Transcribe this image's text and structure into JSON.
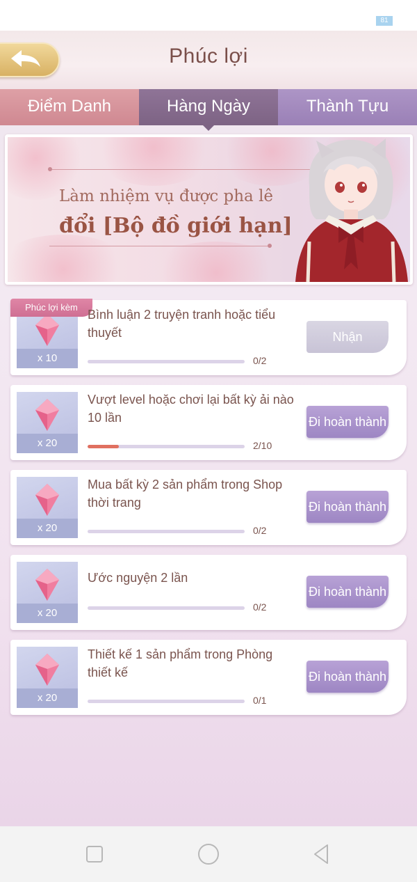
{
  "status_bar": {
    "battery": "81"
  },
  "header": {
    "title": "Phúc lợi"
  },
  "tabs": [
    {
      "label": "Điểm Danh"
    },
    {
      "label": "Hàng Ngày"
    },
    {
      "label": "Thành Tựu"
    }
  ],
  "banner": {
    "line1": "Làm nhiệm vụ được pha lê",
    "line2": "đổi [Bộ đồ giới hạn]"
  },
  "tasks": [
    {
      "title": "Bình luận 2 truyện tranh hoặc tiểu thuyết",
      "reward_qty": "x 10",
      "progress_text": "0/2",
      "progress": 0,
      "button": "Nhận",
      "bonus_tag": "Phúc lợi kèm"
    },
    {
      "title": "Vượt level hoặc chơi lại bất kỳ ải nào 10 lần",
      "reward_qty": "x 20",
      "progress_text": "2/10",
      "progress": 0.2,
      "button": "Đi hoàn thành"
    },
    {
      "title": "Mua bất kỳ 2 sản phẩm trong Shop thời trang",
      "reward_qty": "x 20",
      "progress_text": "0/2",
      "progress": 0,
      "button": "Đi hoàn thành"
    },
    {
      "title": "Ước nguyện 2 lần",
      "reward_qty": "x 20",
      "progress_text": "0/2",
      "progress": 0,
      "button": "Đi hoàn thành"
    },
    {
      "title": "Thiết kế 1 sản phẩm trong Phòng thiết kế",
      "reward_qty": "x 20",
      "progress_text": "0/1",
      "progress": 0,
      "button": "Đi hoàn thành"
    }
  ],
  "colors": {
    "title_text": "#7a4f4a",
    "tab_active": "#7d6384",
    "progress_fill": "#e07060",
    "bonus_tag": "#cf6f93"
  }
}
